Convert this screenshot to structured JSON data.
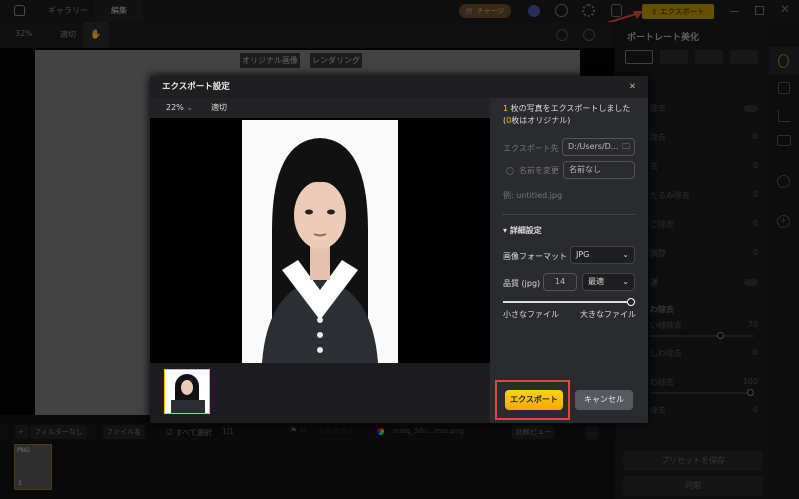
{
  "titlebar": {
    "tabs": [
      "ギャラリー",
      "編集"
    ],
    "active_tab": "編集",
    "charge_label": "チャージ",
    "export_label": "エクスポート",
    "icons": [
      "home-icon",
      "cart-icon",
      "discord-icon",
      "account-icon",
      "settings-icon",
      "sign-out-icon",
      "minimize-icon",
      "maximize-icon",
      "close-icon"
    ]
  },
  "toolbar": {
    "zoom": "32%",
    "fit": "適切",
    "compare_original": "オリジナル画像",
    "compare_rendering": "レンダリング"
  },
  "right_panel": {
    "title": "ポートレート美化",
    "rows": [
      {
        "label": "除去",
        "toggle": false
      },
      {
        "label": "除去",
        "value": "0"
      },
      {
        "label": "去",
        "value": "0"
      },
      {
        "label": "たるみ除去",
        "value": "0"
      },
      {
        "label": "ご除去",
        "value": "0"
      },
      {
        "label": "調整",
        "value": "0"
      },
      {
        "label": "護",
        "toggle": false
      }
    ],
    "section2": "わ除去",
    "rows2": [
      {
        "label": "い線除去",
        "value": "70",
        "slider": 0.7
      },
      {
        "label": "しわ除去",
        "value": "0"
      },
      {
        "label": "わ除去",
        "value": "100",
        "slider": 1.0
      },
      {
        "label": "除去",
        "value": "0"
      }
    ],
    "save_preset": "プリセットを保存",
    "sync": "同期"
  },
  "bottom": {
    "filter": "フィルターなし",
    "sort": "ファイル名",
    "select_all": "すべて選択",
    "count": "1/1",
    "rating": 0,
    "filename": "nobg_5da...ress.png",
    "compare_view": "比較ビュー",
    "thumb_badge": "PNG",
    "thumb_index": "1"
  },
  "dialog": {
    "title": "エクスポート設定",
    "zoom": "22%",
    "fit": "適切",
    "summary_count": "1",
    "summary_text": "枚の写真をエクスポートしました",
    "summary_orig_prefix": "(",
    "summary_orig_count": "0",
    "summary_orig_text": "枚はオリジナル)",
    "dest_label": "エクスポート先",
    "dest_value": "D:/Users/D...",
    "rename_label": "名前を変更",
    "rename_value": "名前なし",
    "rename_checked": false,
    "example": "例: untitled.jpg",
    "advanced": "詳細設定",
    "format_label": "画像フォーマット",
    "format_value": "JPG",
    "quality_label": "品質 (jpg)",
    "quality_value": "14",
    "quality_preset": "最適",
    "size_slider": 1.0,
    "size_small": "小さなファイル",
    "size_large": "大きなファイル",
    "thumb_index": "1",
    "export_button": "エクスポート",
    "cancel_button": "キャンセル"
  }
}
